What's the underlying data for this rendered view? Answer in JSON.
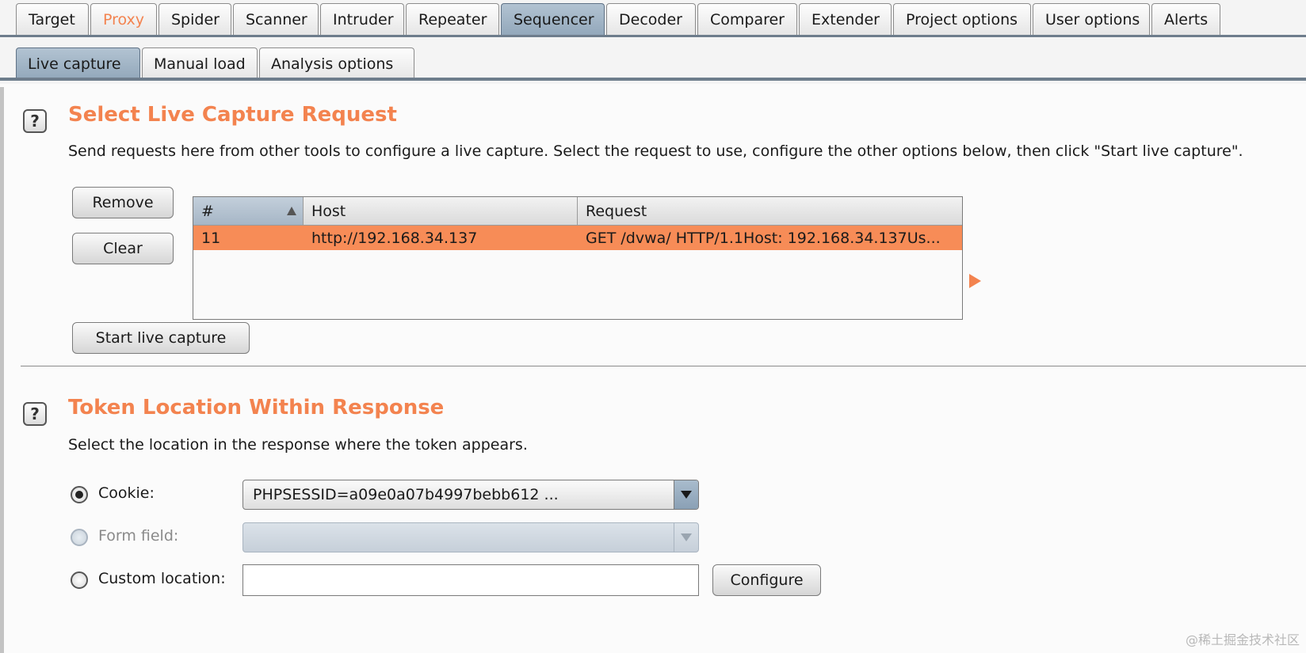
{
  "top_tabs": [
    {
      "label": "Target"
    },
    {
      "label": "Proxy"
    },
    {
      "label": "Spider"
    },
    {
      "label": "Scanner"
    },
    {
      "label": "Intruder"
    },
    {
      "label": "Repeater"
    },
    {
      "label": "Sequencer"
    },
    {
      "label": "Decoder"
    },
    {
      "label": "Comparer"
    },
    {
      "label": "Extender"
    },
    {
      "label": "Project options"
    },
    {
      "label": "User options"
    },
    {
      "label": "Alerts"
    }
  ],
  "active_top_tab": "Sequencer",
  "sub_tabs": [
    {
      "label": "Live capture"
    },
    {
      "label": "Manual load"
    },
    {
      "label": "Analysis options"
    }
  ],
  "active_sub_tab": "Live capture",
  "live_capture": {
    "help_icon": "?",
    "title": "Select Live Capture Request",
    "description": "Send requests here from other tools to configure a live capture. Select the request to use, configure the other options below, then click \"Start live capture\".",
    "remove_label": "Remove",
    "clear_label": "Clear",
    "start_label": "Start live capture",
    "table": {
      "columns": [
        "#",
        "Host",
        "Request"
      ],
      "rows": [
        {
          "num": "11",
          "host": "http://192.168.34.137",
          "request": "GET /dvwa/ HTTP/1.1Host: 192.168.34.137Us..."
        }
      ]
    }
  },
  "token_location": {
    "help_icon": "?",
    "title": "Token Location Within Response",
    "description": "Select the location in the response where the token appears.",
    "cookie_label": "Cookie:",
    "cookie_value": "PHPSESSID=a09e0a07b4997bebb612 ...",
    "form_field_label": "Form field:",
    "custom_location_label": "Custom location:",
    "custom_location_value": "",
    "configure_label": "Configure",
    "selected_option": "Cookie"
  },
  "watermark": "@稀土掘金技术社区",
  "colors": {
    "accent": "#f3834f",
    "selected_row": "#f78c57",
    "active_tab": "#a3b6c8"
  }
}
